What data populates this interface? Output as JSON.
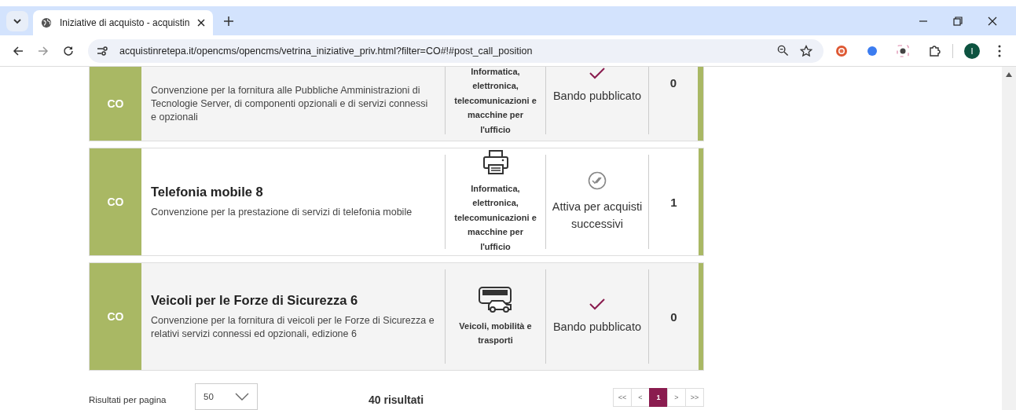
{
  "browser": {
    "tab": {
      "title": "Iniziative di acquisto - acquistin",
      "selected": true
    },
    "url": "acquistinretepa.it/opencms/opencms/vetrina_iniziative_priv.html?filter=CO#!#post_call_position",
    "profile_initial": "I"
  },
  "rows": [
    {
      "badge": "CO",
      "title": "",
      "description": "Convenzione per la fornitura alle Pubbliche Amministrazioni di Tecnologie Server, di componenti opzionali e di servizi connessi e opzionali",
      "category": {
        "label": "Informatica, elettronica, telecomunicazioni e macchine per l'ufficio",
        "kind": "none"
      },
      "status": {
        "label": "Bando pubblicato",
        "kind": "published"
      },
      "count": "0"
    },
    {
      "badge": "CO",
      "title": "Telefonia mobile 8",
      "description": "Convenzione per la prestazione di servizi di telefonia mobile",
      "category": {
        "label": "Informatica, elettronica, telecomunicazioni e macchine per l'ufficio",
        "kind": "printer"
      },
      "status": {
        "label": "Attiva per acquisti successivi",
        "kind": "active"
      },
      "count": "1"
    },
    {
      "badge": "CO",
      "title": "Veicoli per le Forze di Sicurezza 6",
      "description": "Convenzione per la fornitura di veicoli per le Forze di Sicurezza e relativi servizi connessi ed opzionali, edizione 6",
      "category": {
        "label": "Veicoli, mobilità e trasporti",
        "kind": "vehicles"
      },
      "status": {
        "label": "Bando pubblicato",
        "kind": "published"
      },
      "count": "0"
    }
  ],
  "footer": {
    "per_page_label": "Risultati per pagina",
    "per_page_value": "50",
    "total": "40 risultati",
    "pages": [
      {
        "label": "<<",
        "selected": false
      },
      {
        "label": "<",
        "selected": false
      },
      {
        "label": "1",
        "selected": true
      },
      {
        "label": ">",
        "selected": false
      },
      {
        "label": ">>",
        "selected": false
      }
    ]
  }
}
